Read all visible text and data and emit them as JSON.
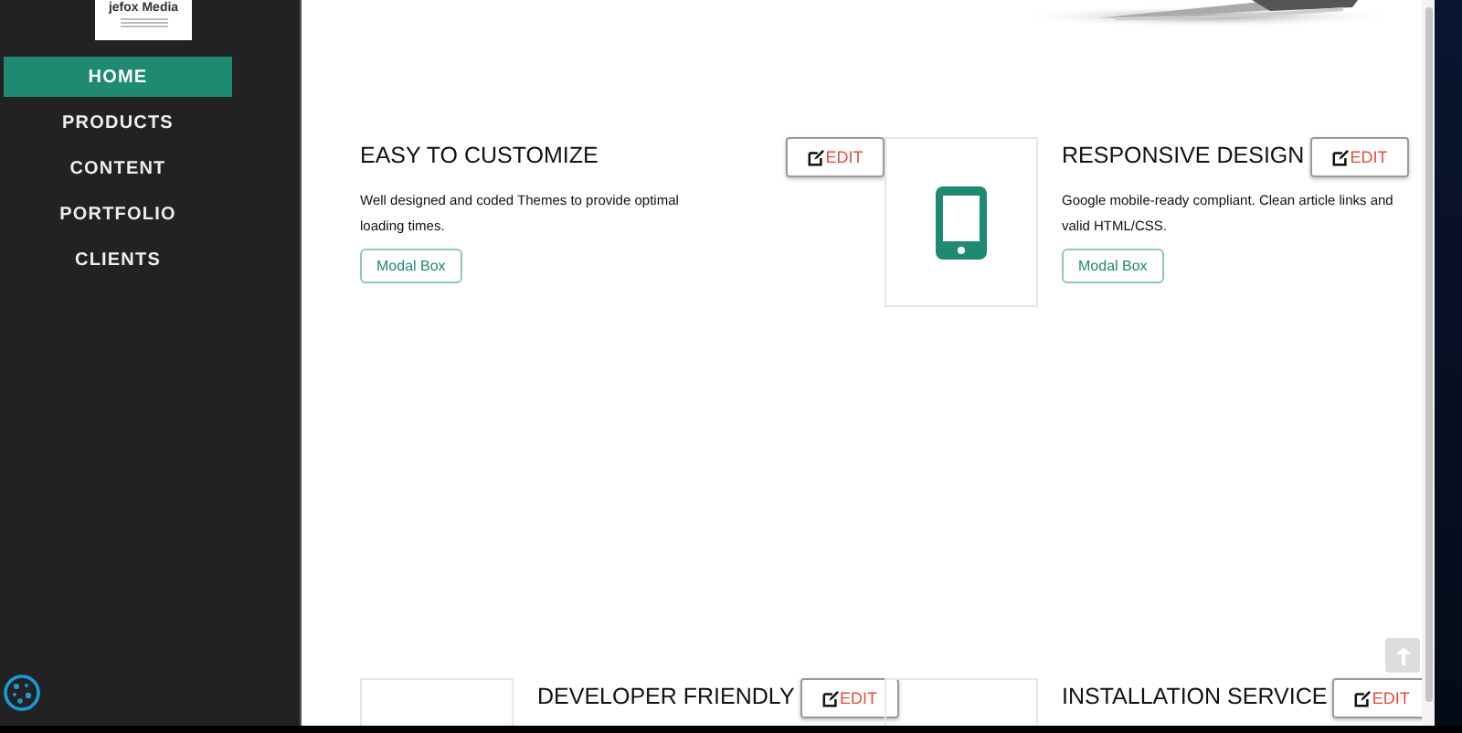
{
  "logo": {
    "text": "jefox Media"
  },
  "nav": [
    {
      "label": "HOME",
      "selected": true
    },
    {
      "label": "PRODUCTS",
      "selected": false
    },
    {
      "label": "CONTENT",
      "selected": false
    },
    {
      "label": "PORTFOLIO",
      "selected": false
    },
    {
      "label": "CLIENTS",
      "selected": false
    }
  ],
  "cards": [
    {
      "kind": "none",
      "title": "EASY TO CUSTOMIZE",
      "edit": "EDIT",
      "text": "Well designed and coded Themes to provide optimal loading times.",
      "button": "Modal Box"
    },
    {
      "kind": "phone",
      "title": "RESPONSIVE DESIGN",
      "edit": "EDIT",
      "text": "Google mobile-ready compliant. Clean article links and valid HTML/CSS.",
      "button": "Modal Box"
    },
    {
      "kind": "blank",
      "title": "DEVELOPER FRIENDLY",
      "edit": "EDIT"
    },
    {
      "kind": "blank",
      "title": "INSTALLATION SERVICE",
      "edit": "EDIT"
    }
  ]
}
